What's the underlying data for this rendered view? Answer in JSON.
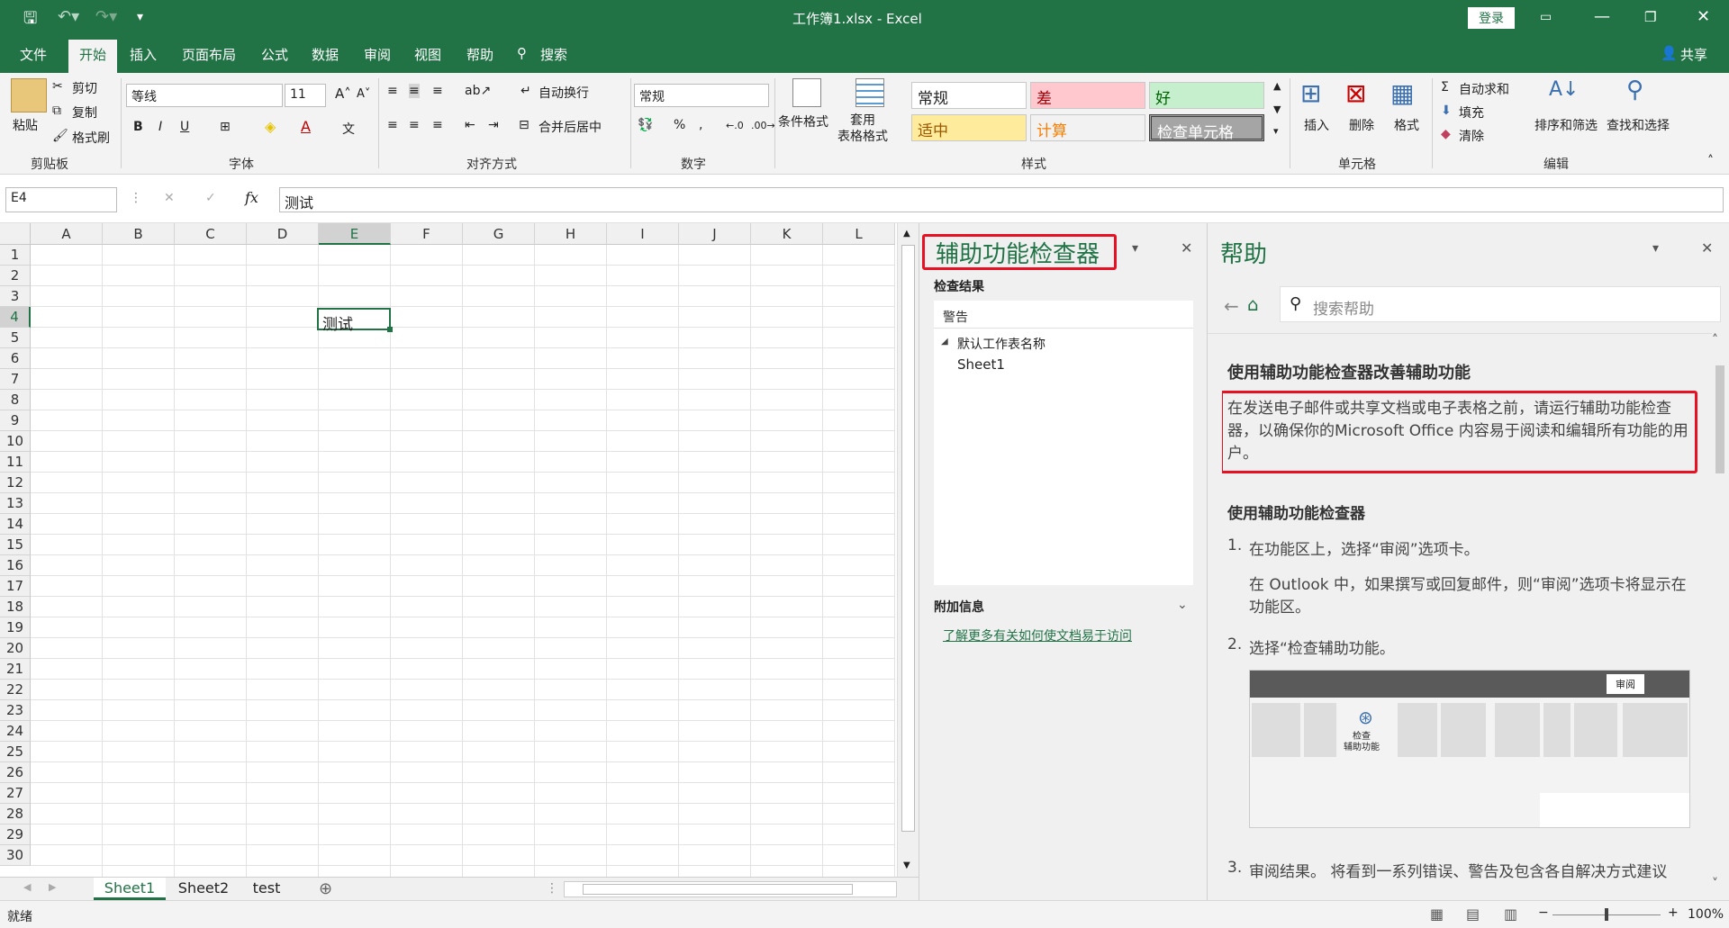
{
  "titlebar": {
    "title": "工作簿1.xlsx  -  Excel",
    "login": "登录"
  },
  "tabs": [
    "文件",
    "开始",
    "插入",
    "页面布局",
    "公式",
    "数据",
    "审阅",
    "视图",
    "帮助",
    "搜索"
  ],
  "share": "共享",
  "clipboard": {
    "paste": "粘贴",
    "cut": "剪切",
    "copy": "复制",
    "format_painter": "格式刷",
    "label": "剪贴板"
  },
  "font": {
    "name": "等线",
    "size": "11",
    "label": "字体",
    "bold": "B",
    "italic": "I",
    "underline": "U"
  },
  "align": {
    "wrap": "自动换行",
    "merge": "合并后居中",
    "label": "对齐方式"
  },
  "number": {
    "format": "常规",
    "percent": "%",
    "comma": ",",
    "label": "数字"
  },
  "styles": {
    "cond": "条件格式",
    "table": "套用\n表格格式",
    "cells": [
      {
        "text": "常规",
        "bg": "#ffffff",
        "fg": "#222222"
      },
      {
        "text": "差",
        "bg": "#ffc7ce",
        "fg": "#9c0006"
      },
      {
        "text": "好",
        "bg": "#c6efce",
        "fg": "#006100"
      },
      {
        "text": "适中",
        "bg": "#ffeb9c",
        "fg": "#9c5700"
      },
      {
        "text": "计算",
        "bg": "#f2f2f2",
        "fg": "#fa7d00"
      },
      {
        "text": "检查单元格",
        "bg": "#a5a5a5",
        "fg": "#ffffff"
      }
    ],
    "label": "样式"
  },
  "cells": {
    "insert": "插入",
    "delete": "删除",
    "format": "格式",
    "label": "单元格"
  },
  "editing": {
    "autosum": "自动求和",
    "fill": "填充",
    "clear": "清除",
    "sort": "排序和筛选",
    "find": "查找和选择",
    "label": "编辑"
  },
  "formula": {
    "namebox": "E4",
    "fx": "fx",
    "content": "测试"
  },
  "grid": {
    "columns": [
      "A",
      "B",
      "C",
      "D",
      "E",
      "F",
      "G",
      "H",
      "I",
      "J",
      "K",
      "L"
    ],
    "rows": [
      "1",
      "2",
      "3",
      "4",
      "5",
      "6",
      "7",
      "8",
      "9",
      "10",
      "11",
      "12",
      "13",
      "14",
      "15",
      "16",
      "17",
      "18",
      "19",
      "20",
      "21",
      "22",
      "23",
      "24",
      "25",
      "26",
      "27",
      "28",
      "29",
      "30"
    ],
    "selected": "E4",
    "cell_text": "测试"
  },
  "sheets": [
    "Sheet1",
    "Sheet2",
    "test"
  ],
  "checker": {
    "title": "辅助功能检查器",
    "results": "检查结果",
    "warnings": "警告",
    "item": "默认工作表名称",
    "sheet": "Sheet1",
    "extra": "附加信息",
    "link": "了解更多有关如何使文档易于访问"
  },
  "help": {
    "title": "帮助",
    "search_placeholder": "搜索帮助",
    "h1": "使用辅助功能检查器改善辅助功能",
    "p1": "在发送电子邮件或共享文档或电子表格之前，请运行辅助功能检查器，以确保你的Microsoft Office 内容易于阅读和编辑所有功能的用户。",
    "h2": "使用辅助功能检查器",
    "s1": "在功能区上，选择“审阅”选项卡。",
    "s1b": "在 Outlook 中，如果撰写或回复邮件，则“审阅”选项卡将显示在功能区。",
    "s2": "选择“检查辅助功能。",
    "img_tab": "审阅",
    "img_btn": "检查\n辅助功能",
    "s3": "审阅结果。 将看到一系列错误、警告及包含各自解决方式建议"
  },
  "status": {
    "ready": "就绪",
    "zoom": "100%"
  }
}
